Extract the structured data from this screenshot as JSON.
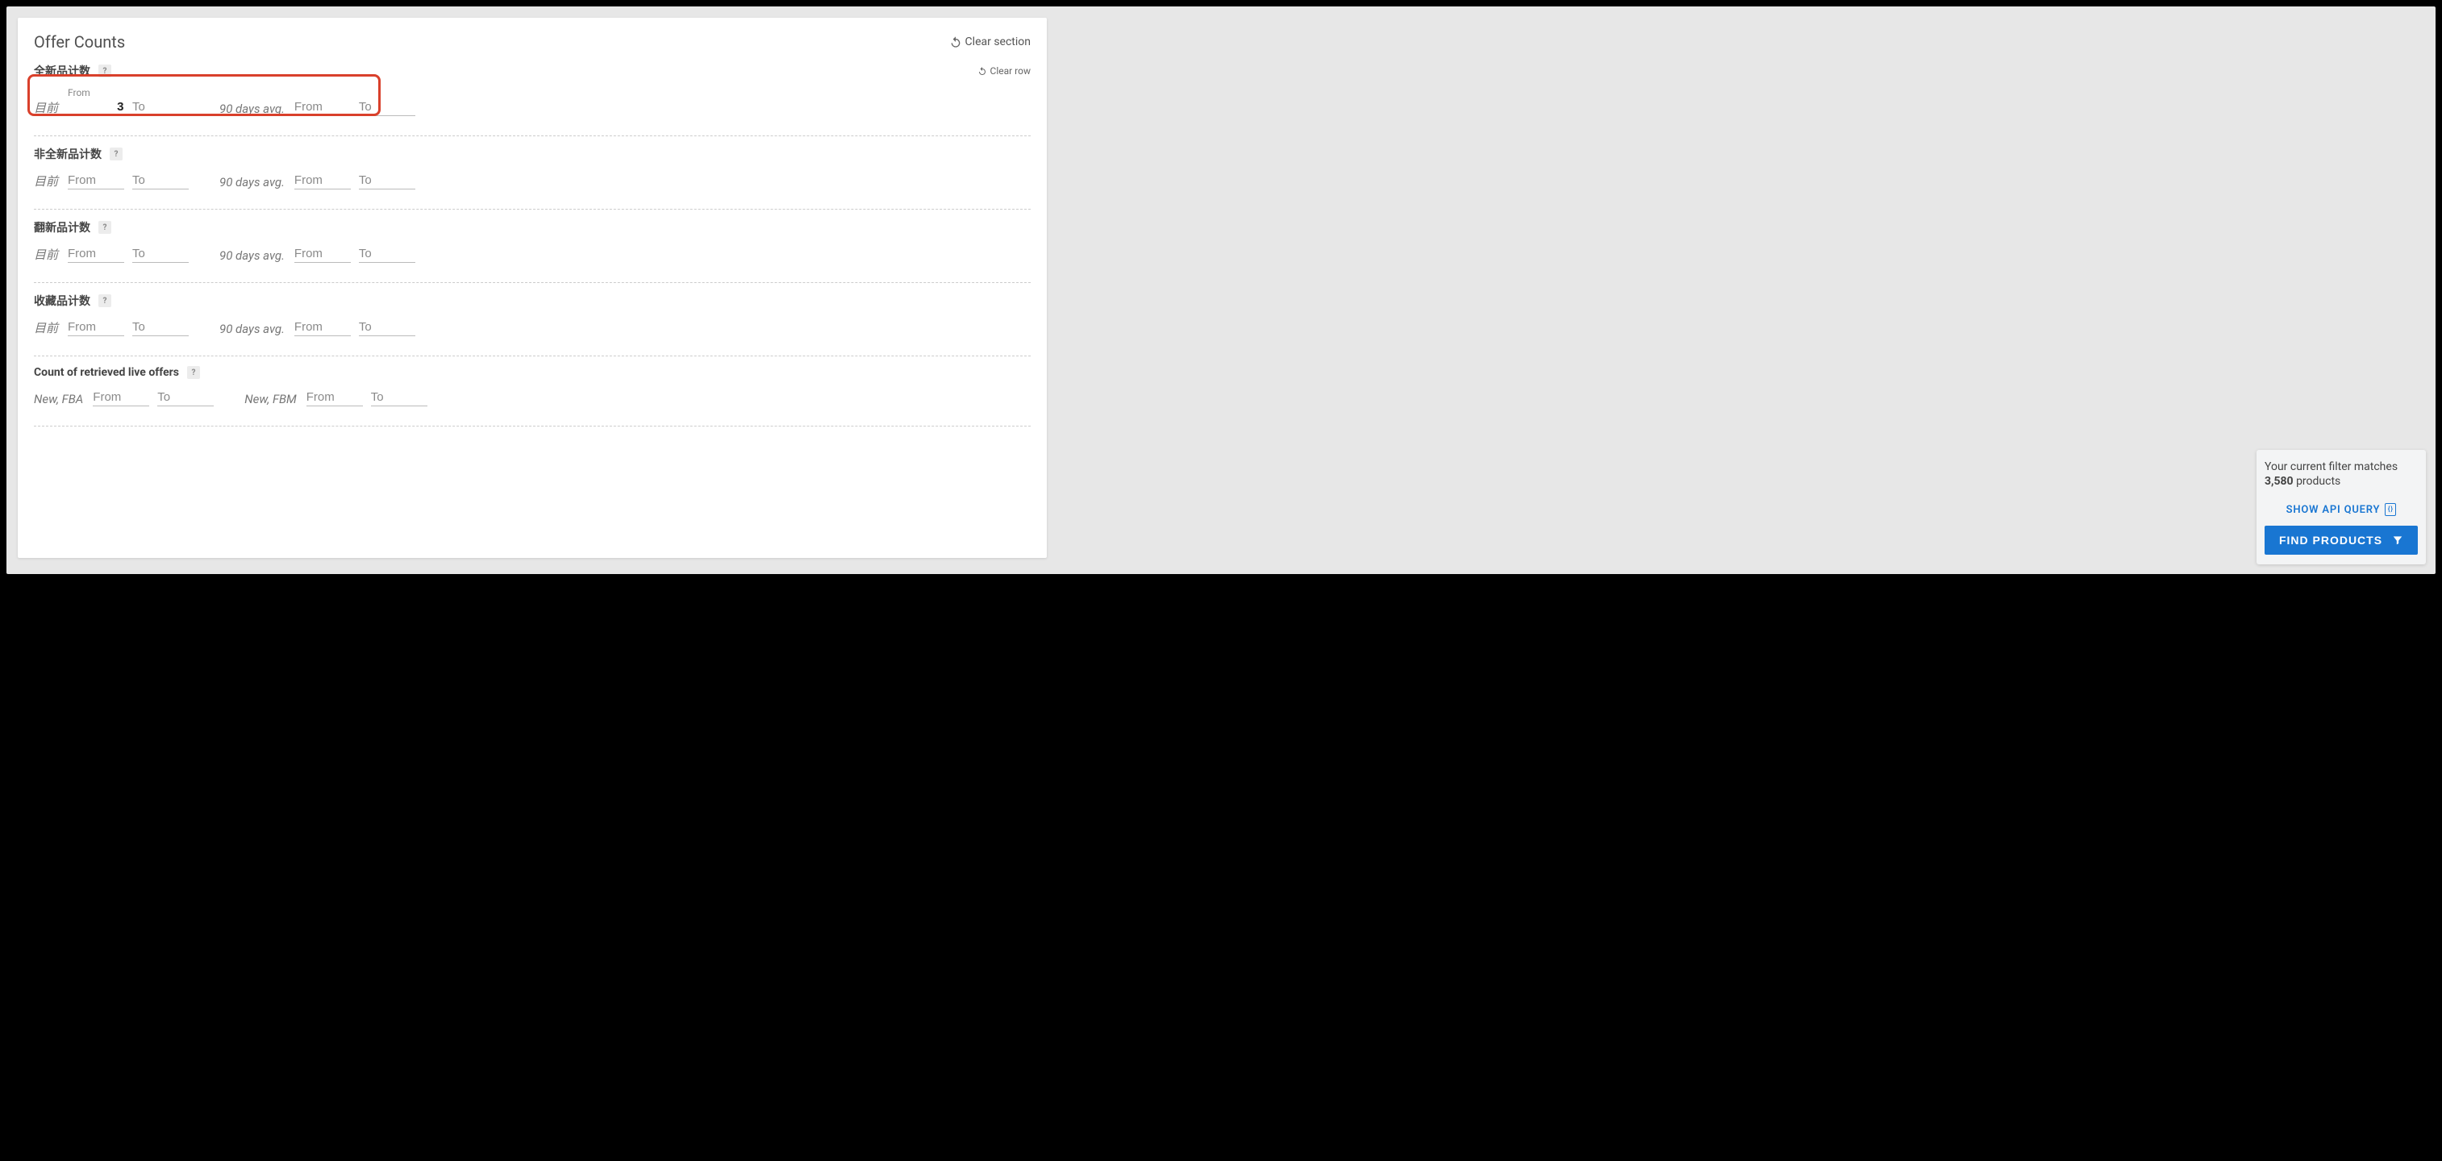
{
  "section": {
    "title": "Offer Counts",
    "clear_section": "Clear section",
    "clear_row": "Clear row"
  },
  "labels": {
    "current": "目前",
    "avg90": "90 days avg.",
    "from": "From",
    "to": "To",
    "new_fba": "New, FBA",
    "new_fbm": "New, FBM"
  },
  "rows": {
    "new_count": {
      "label": "全新品计数",
      "current_from": "3"
    },
    "non_new_count": {
      "label": "非全新品计数"
    },
    "refurb_count": {
      "label": "翻新品计数"
    },
    "collectible_count": {
      "label": "收藏品计数"
    },
    "live_offers": {
      "label": "Count of retrieved live offers"
    }
  },
  "results": {
    "prefix": "Your current filter matches",
    "count": "3,580",
    "suffix": "products",
    "show_api": "SHOW API QUERY",
    "find_products": "FIND PRODUCTS"
  }
}
